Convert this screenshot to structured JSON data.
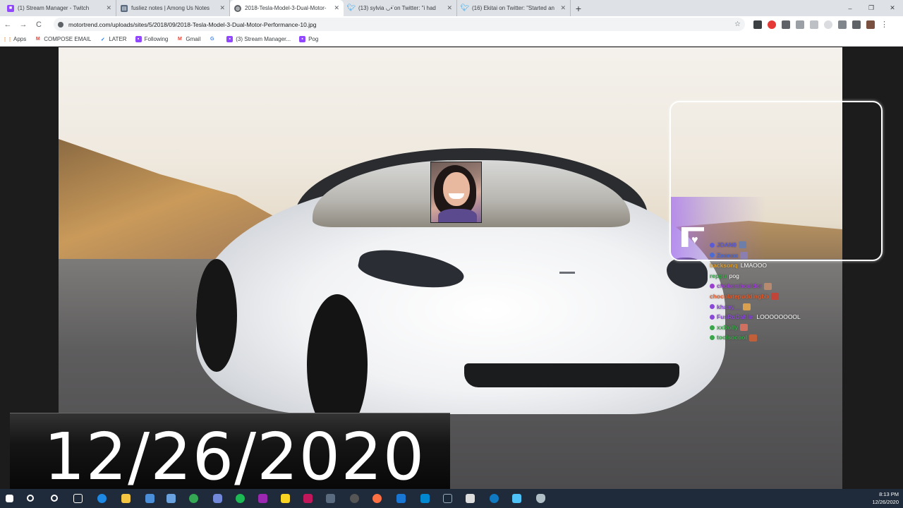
{
  "browser": {
    "tabs": [
      {
        "title": "(1) Stream Manager - Twitch",
        "favicon": "twitch-icon",
        "color": "#9146ff"
      },
      {
        "title": "fusliez notes | Among Us Notes",
        "favicon": "notes-icon",
        "color": "#5b6b7f"
      },
      {
        "title": "2018-Tesla-Model-3-Dual-Motor-",
        "favicon": "globe-icon",
        "color": "#5f6368",
        "active": true
      },
      {
        "title": "(13) sylvia ◡•̈ on Twitter: \"i had",
        "favicon": "twitter-icon",
        "color": "#1da1f2"
      },
      {
        "title": "(16) Ekitai on Twitter: \"Started an",
        "favicon": "twitter-icon",
        "color": "#1da1f2"
      }
    ],
    "new_tab": "+",
    "window_controls": {
      "minimize": "–",
      "maximize": "❐",
      "close": "✕"
    },
    "nav": {
      "back": "←",
      "forward": "→",
      "reload": "C"
    },
    "address": "motortrend.com/uploads/sites/5/2018/09/2018-Tesla-Model-3-Dual-Motor-Performance-10.jpg",
    "bookmarks": [
      {
        "label": "Apps",
        "icon": "apps-grid-icon",
        "color": "#e8710a"
      },
      {
        "label": "COMPOSE EMAIL",
        "icon": "gmail-icon",
        "color": "#ea4335"
      },
      {
        "label": "LATER",
        "icon": "later-icon",
        "color": "#1a73e8"
      },
      {
        "label": "Following",
        "icon": "twitch-icon",
        "color": "#9146ff"
      },
      {
        "label": "Gmail",
        "icon": "gmail-icon",
        "color": "#ea4335"
      },
      {
        "label": "",
        "icon": "google-icon",
        "color": "#4285f4"
      },
      {
        "label": "(3) Stream Manager...",
        "icon": "twitch-icon",
        "color": "#9146ff"
      },
      {
        "label": "Pog",
        "icon": "twitch-icon",
        "color": "#9146ff"
      }
    ]
  },
  "chat": [
    {
      "user": "JDAN0",
      "color": "#5b5bd6",
      "msg": "",
      "emote": "#6d7fa8"
    },
    {
      "user": "Zeonox",
      "color": "#4b6bd6",
      "msg": "",
      "emote": "#8a7fb0"
    },
    {
      "user": "backsonq",
      "color": "#e0a030",
      "msg": "LMAOOO",
      "emote": ""
    },
    {
      "user": "reppu",
      "color": "#3aa64a",
      "msg": "pog",
      "emote": ""
    },
    {
      "user": "chokershoulder",
      "color": "#9a3fcf",
      "msg": "",
      "emote": "#b78a70"
    },
    {
      "user": "chocolatepuddingbb",
      "color": "#e65a2a",
      "msg": "",
      "emote": "#c2453a"
    },
    {
      "user": "khany__",
      "color": "#8a48d8",
      "msg": "",
      "emote": "#d9a050"
    },
    {
      "user": "FusRoDahlin",
      "color": "#8a48d8",
      "msg": "LOOOOOOOOL",
      "emote": ""
    },
    {
      "user": "xxDolly",
      "color": "#3aa64a",
      "msg": "",
      "emote": "#d07060"
    },
    {
      "user": "toolsocool",
      "color": "#3aa64a",
      "msg": "",
      "emote": "#c0603a"
    }
  ],
  "caption": {
    "date": "12/26/2020"
  },
  "taskbar": {
    "start": "⊞",
    "clock_time": "8:13 PM",
    "clock_date": "12/26/2020",
    "icons": [
      "search-icon",
      "cortana-icon",
      "taskview-icon",
      "edge-icon",
      "explorer-icon",
      "chrome-icon",
      "discord-icon",
      "spotify-icon",
      "obs-icon",
      "notes-icon",
      "photos-icon",
      "steam-icon",
      "app-icon",
      "firefox-icon",
      "mail-icon",
      "store-icon",
      "steam-icon",
      "vscode-icon",
      "ccleaner-icon",
      "photos-icon",
      "shield-icon"
    ]
  }
}
